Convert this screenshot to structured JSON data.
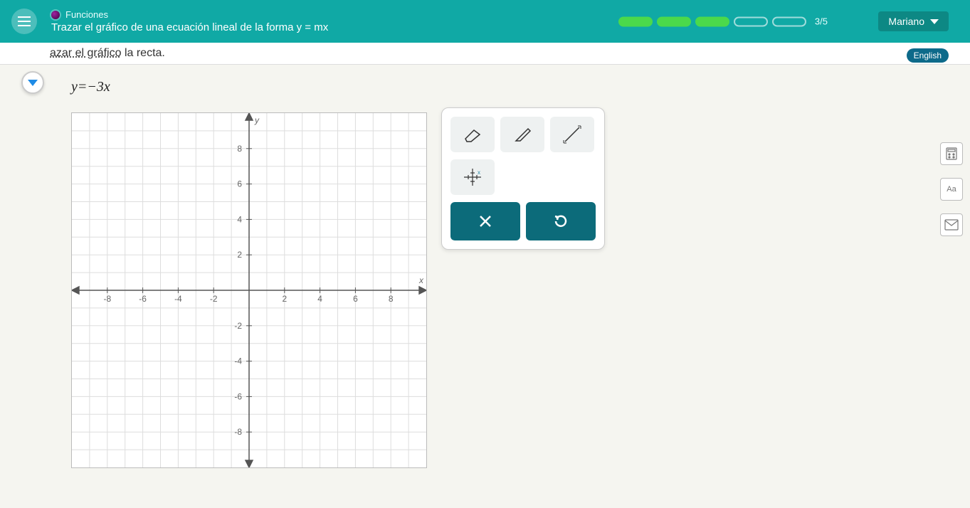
{
  "header": {
    "breadcrumb": "Funciones",
    "lesson": "Trazar el gráfico de una ecuación lineal de la forma y = mx",
    "progress": {
      "filled": 3,
      "total": 5,
      "label": "3/5"
    },
    "user": "Mariano"
  },
  "question": {
    "prefix": "azar el gráfico",
    "suffix": " la recta.",
    "equation_y": "y",
    "equation_eq": "=",
    "equation_neg": "−",
    "equation_coef": "3",
    "equation_x": "x"
  },
  "lang_button": "English",
  "graph": {
    "x_label": "x",
    "y_label": "y",
    "ticks_neg": [
      "-8",
      "-6",
      "-4",
      "-2"
    ],
    "ticks_pos": [
      "2",
      "4",
      "6",
      "8"
    ]
  },
  "chart_data": {
    "type": "line",
    "title": "",
    "xlabel": "x",
    "ylabel": "y",
    "xlim": [
      -10,
      10
    ],
    "ylim": [
      -10,
      10
    ],
    "x_ticks": [
      -8,
      -6,
      -4,
      -2,
      2,
      4,
      6,
      8
    ],
    "y_ticks": [
      -8,
      -6,
      -4,
      -2,
      2,
      4,
      6,
      8
    ],
    "series": [
      {
        "name": "y = -3x",
        "x": [],
        "y": []
      }
    ]
  },
  "tools": {
    "eraser": "eraser",
    "pencil": "pencil",
    "line": "line-tool",
    "grid": "grid-tool",
    "clear": "×",
    "undo": "↺"
  },
  "side": {
    "calc": "calculator",
    "font": "Aa",
    "mail": "mail"
  }
}
